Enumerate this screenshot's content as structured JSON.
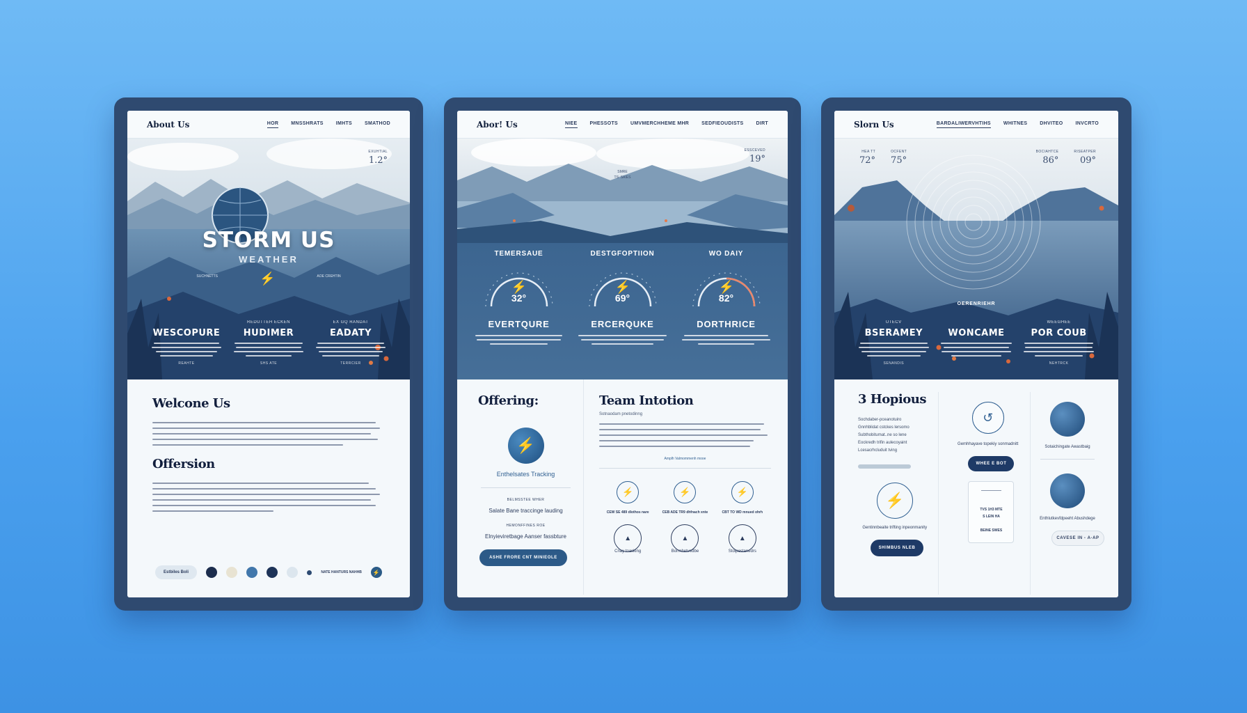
{
  "tablets": [
    {
      "nav": {
        "brand": "About Us",
        "links": [
          "HOR",
          "MNSSHRATS",
          "IMHTS",
          "SMATHOD"
        ]
      },
      "hero": {
        "temp": {
          "label": "EXUHTIAL",
          "value": "1.2°"
        },
        "logo_title": "STORM US",
        "logo_subtitle": "WEATHER",
        "caption": "SUCHNETTS",
        "caption2": "AOE CREHTIN",
        "columns": [
          {
            "small": "",
            "heading": "WESCOPURE",
            "foot": "REAHTE"
          },
          {
            "small": "REDUTTEH ECKEN",
            "heading": "HUDIMER",
            "foot": "SHS ATE"
          },
          {
            "small": "EX GQ RANDAT",
            "heading": "EADATY",
            "foot": "TERRCIER"
          }
        ]
      },
      "content": {
        "title1": "Welcone Us",
        "title2": "Offersion",
        "pill": "Estbiles Boli",
        "trail": "NATE HANTURS NAHHB"
      }
    },
    {
      "nav": {
        "brand": "Abor! Us",
        "links": [
          "NIEE",
          "PHESSOTS",
          "UMVMERCHHEME MHR",
          "SEDFIEOUDISTS",
          "DIRT"
        ]
      },
      "hero": {
        "temp": {
          "label": "ESSCEVED",
          "value": "19°"
        },
        "center_small": "SMRE",
        "center_small2": "TS: SAIES",
        "gauges": [
          {
            "caption": "TEMERSAUE",
            "value": "32°",
            "heading": "EVERTQURE"
          },
          {
            "caption": "DESTGFOPTIION",
            "value": "69°",
            "heading": "ERCERQUKE"
          },
          {
            "caption": "WO DAIY",
            "value": "82°",
            "heading": "DORTHRICE"
          }
        ]
      },
      "offering": {
        "title": "Offering:",
        "feature_label": "Enthelsates Tracking",
        "sub_small": "BELMSSTEE WHER",
        "link1": "Salate Bane traccinge lauding",
        "sub_small2": "HEMONFFINES ROE",
        "link2": "Elnyieviretbage Aanser fassbture",
        "button": "ASHE FRORE CNT MINIEOLE"
      },
      "team": {
        "title": "Team Intotion",
        "subtitle": "Sotnaodam pnetodinng",
        "link": "Amplh Valmommenh mooe",
        "icons": [
          {
            "label": "CEW SE 489 dlothos nare"
          },
          {
            "label": "CEB ADE TR9 dhfnach xnte"
          },
          {
            "label": "CBT TO WD mnued ohrh"
          }
        ],
        "links": [
          "Cnay toasking",
          "Borrnhetvedbe",
          "Stoipestanedrs"
        ]
      }
    },
    {
      "nav": {
        "brand": "Slorn Us",
        "links": [
          "BARDALIWERVHTIHS",
          "WHITNES",
          "DHVITEO",
          "INVCRTO"
        ]
      },
      "hero": {
        "temps": [
          {
            "label": "HEA TT",
            "value": "72°"
          },
          {
            "label": "OCFENT",
            "value": "75°"
          },
          {
            "label": "BOCIAHTCE",
            "value": "86°"
          },
          {
            "label": "RISEATPER",
            "value": "09°"
          }
        ],
        "center_small": "OERENRIEHR",
        "columns": [
          {
            "small": "UTECV",
            "heading": "BSERAMEY",
            "foot": "SENANDIS"
          },
          {
            "small": "",
            "heading": "WONCAME",
            "foot": ""
          },
          {
            "small": "WEEGHEE",
            "heading": "POR COUB",
            "foot": "NEHTRCK"
          }
        ]
      },
      "content": {
        "title": "3 Hopious",
        "intro": [
          "Sochdaber-pceanotuiro",
          "Gnnhblidat cstckes lersomo",
          "Subthobitumat..ne so lene",
          "Eockredh trifin aulecoyaint",
          "Lcesacrhcluduit tving"
        ],
        "card1_text": "Gemhhayave topekiy sonmadnitt",
        "card1_button": "WHEE E BOT",
        "card2_text": "Gentinnbeaite trifting inpeonmanity",
        "card2_button": "SHIMBUS NLEB",
        "stat_lines": [
          "TVS 1H3 MTE",
          "S LEIN HA",
          "BEINE SWES"
        ],
        "right1": "Sotaichingate Awastbaig",
        "right2": "Enthlutkevfdpeeht Abushdege",
        "right_button": "CAVESE IN - A-AP"
      }
    }
  ]
}
